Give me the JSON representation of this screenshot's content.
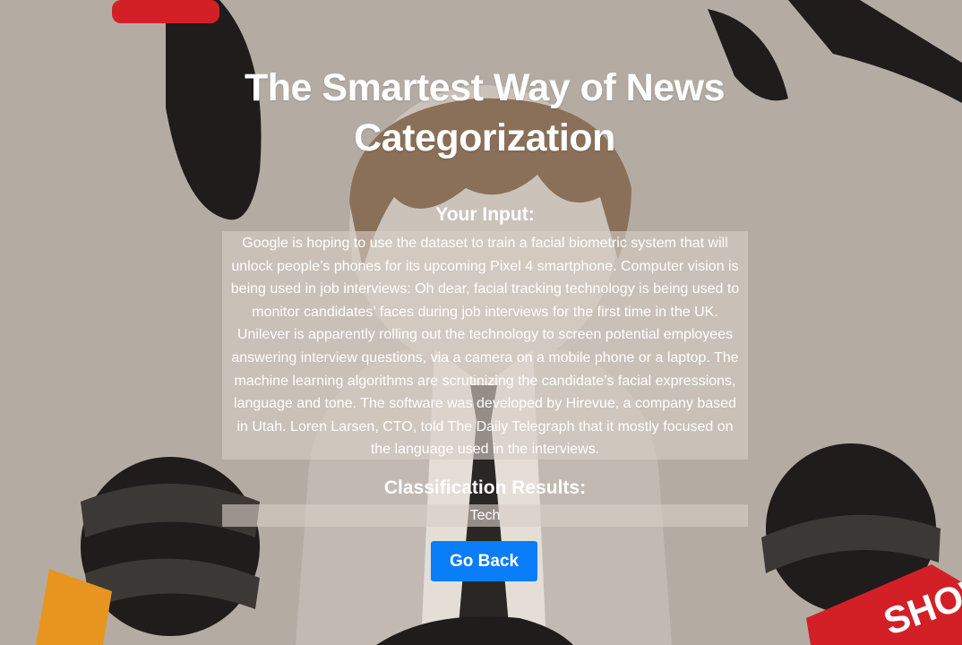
{
  "page": {
    "title": "The Smartest Way of News Categorization"
  },
  "input_section": {
    "heading": "Your Input:",
    "text": "Google is hoping to use the dataset to train a facial biometric system that will unlock people’s phones for its upcoming Pixel 4 smartphone. Computer vision is being used in job interviews: Oh dear, facial tracking technology is being used to monitor candidates’ faces during job interviews for the first time in the UK. Unilever is apparently rolling out the technology to screen potential employees answering interview questions, via a camera on a mobile phone or a laptop. The machine learning algorithms are scrutinizing the candidate’s facial expressions, language and tone. The software was developed by Hirevue, a company based in Utah. Loren Larsen, CTO, told The Daily Telegraph that it mostly focused on the language used in the interviews."
  },
  "results_section": {
    "heading": "Classification Results:",
    "result": "Tech"
  },
  "actions": {
    "go_back_label": "Go Back"
  },
  "colors": {
    "background": "#b4aca3",
    "button": "#0a7df8",
    "text": "#ffffff"
  }
}
